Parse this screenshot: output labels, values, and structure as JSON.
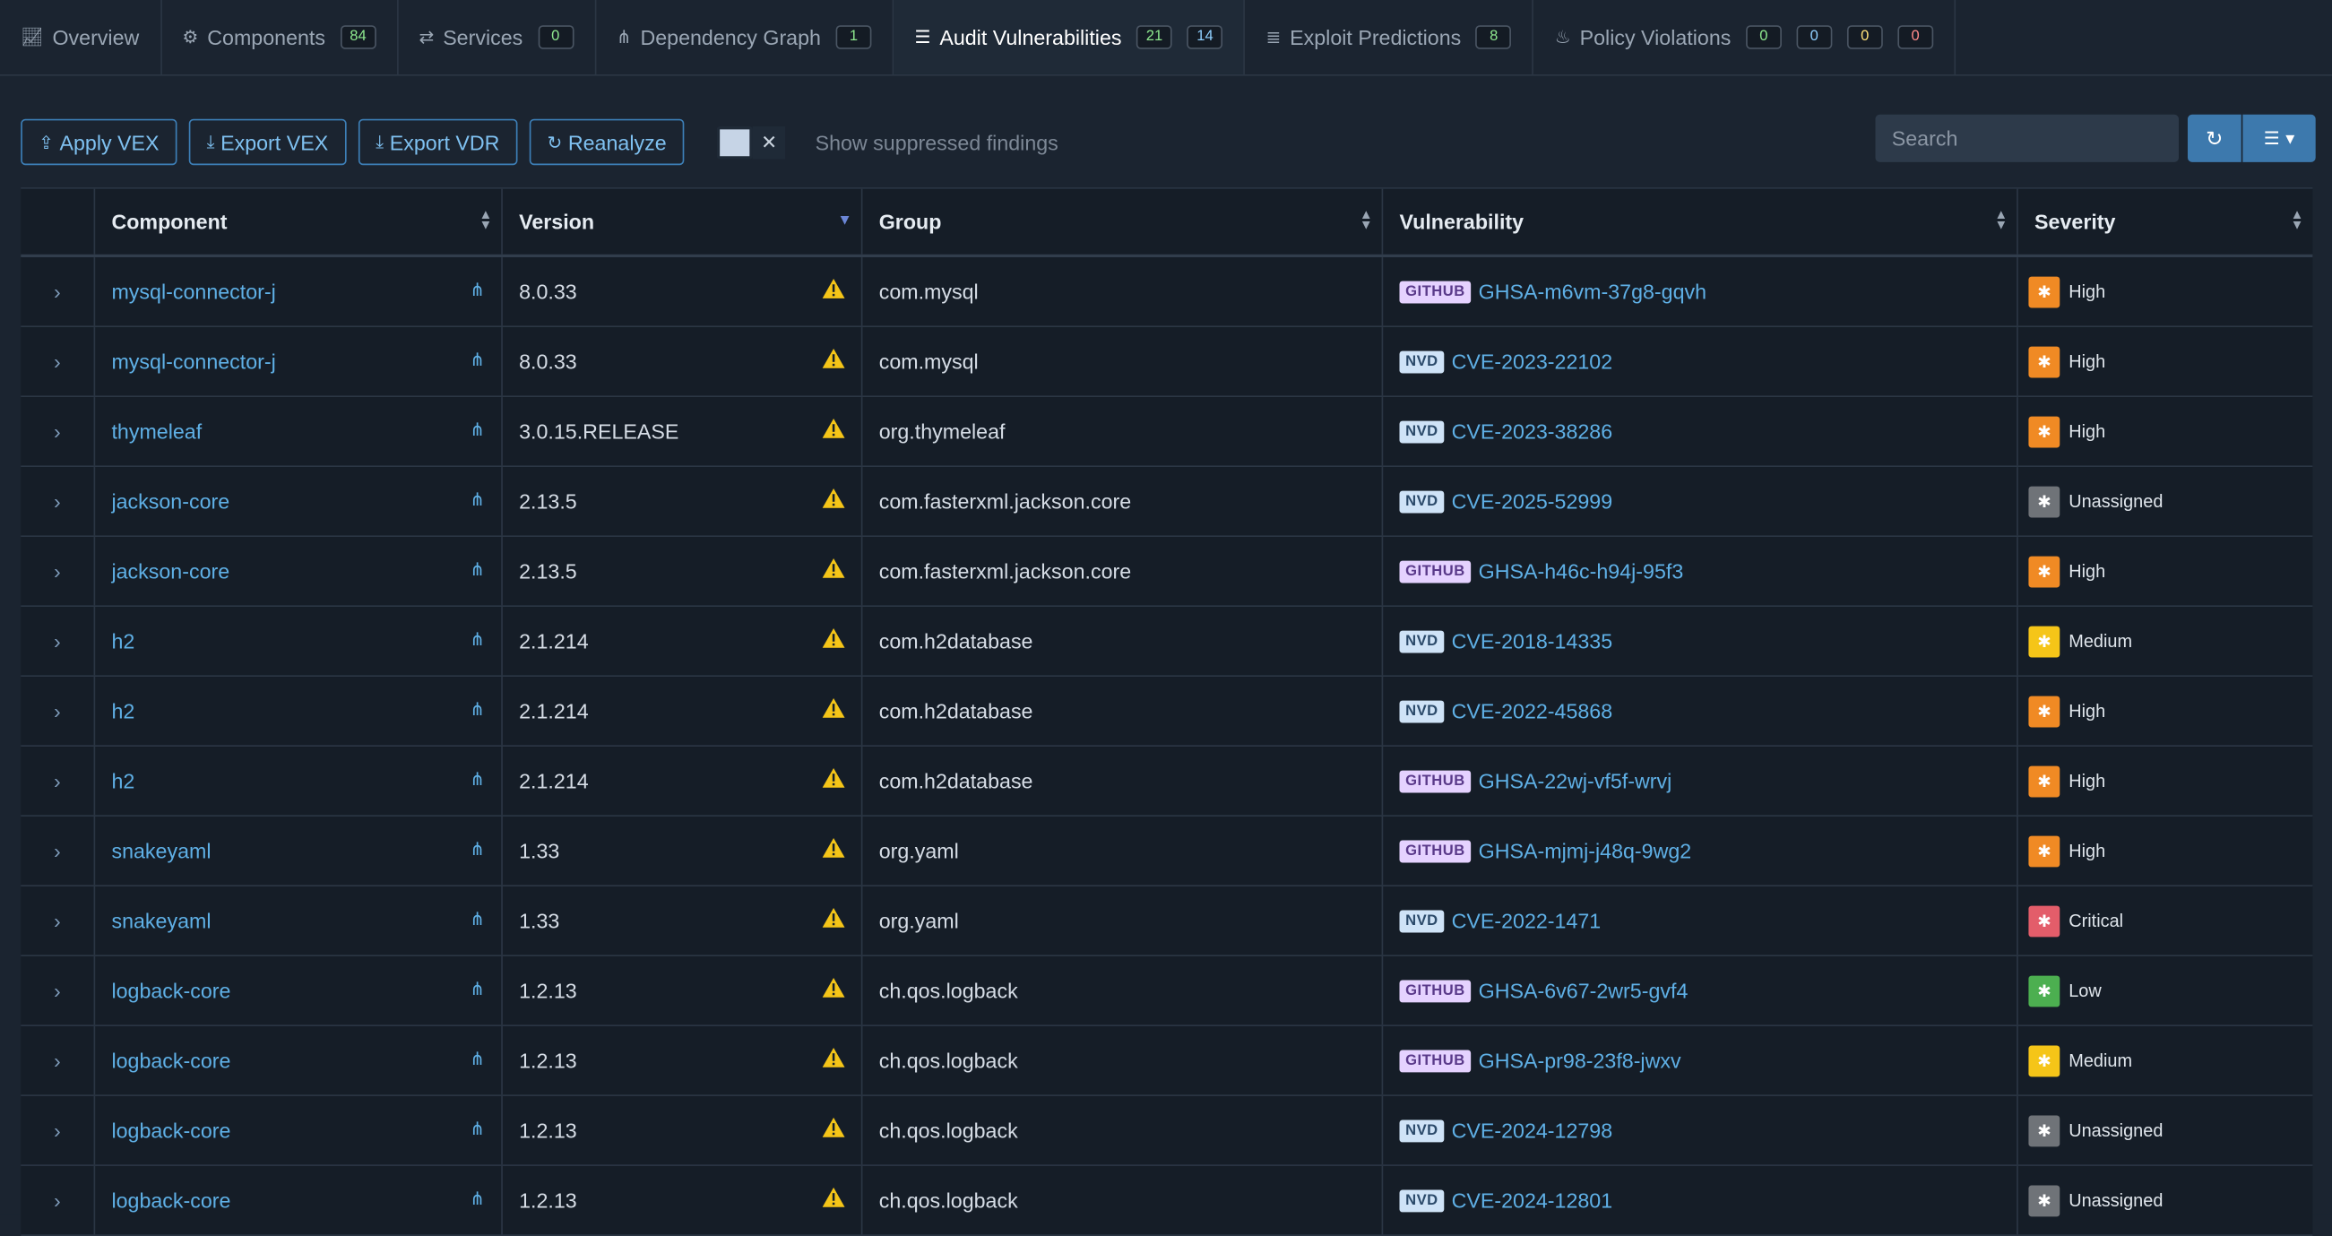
{
  "tabs": [
    {
      "label": "Overview",
      "icon": "chart-line-icon",
      "badges": []
    },
    {
      "label": "Components",
      "icon": "cubes-icon",
      "badges": [
        {
          "value": "84",
          "color": "green"
        }
      ]
    },
    {
      "label": "Services",
      "icon": "exchange-icon",
      "badges": [
        {
          "value": "0",
          "color": "green"
        }
      ]
    },
    {
      "label": "Dependency Graph",
      "icon": "sitemap-icon",
      "badges": [
        {
          "value": "1",
          "color": "green"
        }
      ]
    },
    {
      "label": "Audit Vulnerabilities",
      "icon": "tasks-icon",
      "active": true,
      "badges": [
        {
          "value": "21",
          "color": "green"
        },
        {
          "value": "14",
          "color": "blue"
        }
      ]
    },
    {
      "label": "Exploit Predictions",
      "icon": "server-icon",
      "badges": [
        {
          "value": "8",
          "color": "green"
        }
      ]
    },
    {
      "label": "Policy Violations",
      "icon": "fire-icon",
      "badges": [
        {
          "value": "0",
          "color": "green"
        },
        {
          "value": "0",
          "color": "blue"
        },
        {
          "value": "0",
          "color": "yellow"
        },
        {
          "value": "0",
          "color": "red"
        }
      ]
    }
  ],
  "toolbar": {
    "apply_vex": "Apply VEX",
    "export_vex": "Export VEX",
    "export_vdr": "Export VDR",
    "reanalyze": "Reanalyze",
    "show_suppressed": "Show suppressed findings",
    "toggle_x": "✕"
  },
  "search": {
    "placeholder": "Search"
  },
  "columns": {
    "component": "Component",
    "version": "Version",
    "group": "Group",
    "vulnerability": "Vulnerability",
    "severity": "Severity"
  },
  "severity_colors": {
    "High": "#f08a24",
    "Unassigned": "#6f7378",
    "Medium": "#f5c518",
    "Critical": "#e35d6a",
    "Low": "#4caf50"
  },
  "rows": [
    {
      "component": "mysql-connector-j",
      "version": "8.0.33",
      "group": "com.mysql",
      "source": "GITHUB",
      "vuln": "GHSA-m6vm-37g8-gqvh",
      "severity": "High"
    },
    {
      "component": "mysql-connector-j",
      "version": "8.0.33",
      "group": "com.mysql",
      "source": "NVD",
      "vuln": "CVE-2023-22102",
      "severity": "High"
    },
    {
      "component": "thymeleaf",
      "version": "3.0.15.RELEASE",
      "group": "org.thymeleaf",
      "source": "NVD",
      "vuln": "CVE-2023-38286",
      "severity": "High"
    },
    {
      "component": "jackson-core",
      "version": "2.13.5",
      "group": "com.fasterxml.jackson.core",
      "source": "NVD",
      "vuln": "CVE-2025-52999",
      "severity": "Unassigned"
    },
    {
      "component": "jackson-core",
      "version": "2.13.5",
      "group": "com.fasterxml.jackson.core",
      "source": "GITHUB",
      "vuln": "GHSA-h46c-h94j-95f3",
      "severity": "High"
    },
    {
      "component": "h2",
      "version": "2.1.214",
      "group": "com.h2database",
      "source": "NVD",
      "vuln": "CVE-2018-14335",
      "severity": "Medium"
    },
    {
      "component": "h2",
      "version": "2.1.214",
      "group": "com.h2database",
      "source": "NVD",
      "vuln": "CVE-2022-45868",
      "severity": "High"
    },
    {
      "component": "h2",
      "version": "2.1.214",
      "group": "com.h2database",
      "source": "GITHUB",
      "vuln": "GHSA-22wj-vf5f-wrvj",
      "severity": "High"
    },
    {
      "component": "snakeyaml",
      "version": "1.33",
      "group": "org.yaml",
      "source": "GITHUB",
      "vuln": "GHSA-mjmj-j48q-9wg2",
      "severity": "High"
    },
    {
      "component": "snakeyaml",
      "version": "1.33",
      "group": "org.yaml",
      "source": "NVD",
      "vuln": "CVE-2022-1471",
      "severity": "Critical"
    },
    {
      "component": "logback-core",
      "version": "1.2.13",
      "group": "ch.qos.logback",
      "source": "GITHUB",
      "vuln": "GHSA-6v67-2wr5-gvf4",
      "severity": "Low"
    },
    {
      "component": "logback-core",
      "version": "1.2.13",
      "group": "ch.qos.logback",
      "source": "GITHUB",
      "vuln": "GHSA-pr98-23f8-jwxv",
      "severity": "Medium"
    },
    {
      "component": "logback-core",
      "version": "1.2.13",
      "group": "ch.qos.logback",
      "source": "NVD",
      "vuln": "CVE-2024-12798",
      "severity": "Unassigned"
    },
    {
      "component": "logback-core",
      "version": "1.2.13",
      "group": "ch.qos.logback",
      "source": "NVD",
      "vuln": "CVE-2024-12801",
      "severity": "Unassigned"
    }
  ]
}
